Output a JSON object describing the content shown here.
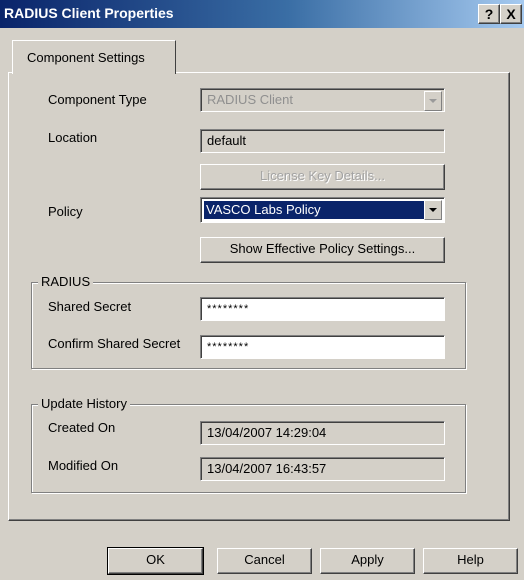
{
  "window": {
    "title": "RADIUS Client Properties",
    "help_label": "?",
    "close_label": "X"
  },
  "tabs": [
    {
      "label": "Component Settings"
    }
  ],
  "component": {
    "type_label": "Component Type",
    "type_value": "RADIUS Client",
    "location_label": "Location",
    "location_value": "default",
    "license_button": "License Key Details...",
    "policy_label": "Policy",
    "policy_value": "VASCO Labs Policy",
    "effective_button": "Show Effective Policy Settings..."
  },
  "radius": {
    "title": "RADIUS",
    "secret_label": "Shared Secret",
    "secret_value": "********",
    "confirm_label": "Confirm Shared Secret",
    "confirm_value": "********"
  },
  "history": {
    "title": "Update History",
    "created_label": "Created On",
    "created_value": "13/04/2007 14:29:04",
    "modified_label": "Modified On",
    "modified_value": "13/04/2007 16:43:57"
  },
  "buttons": {
    "ok": "OK",
    "cancel": "Cancel",
    "apply": "Apply",
    "help": "Help"
  },
  "colors": {
    "titlebar": "#0a246a",
    "face": "#d4d0c8",
    "selection": "#0a246a"
  },
  "icons": {
    "dropdown": "chevron-down-icon"
  }
}
